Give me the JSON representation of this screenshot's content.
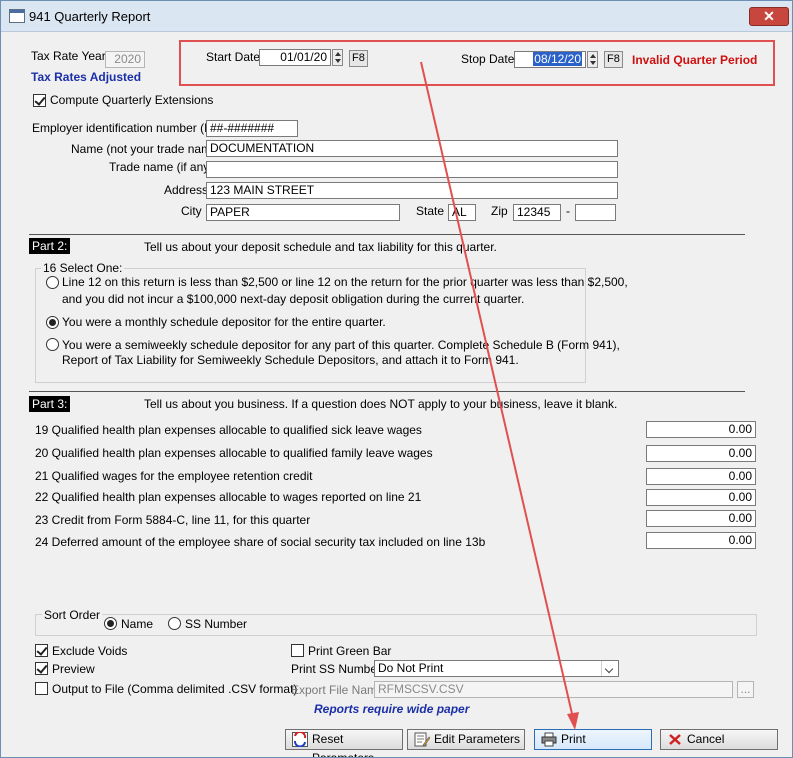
{
  "window": {
    "title": "941 Quarterly Report",
    "close_symbol": "✕"
  },
  "header": {
    "tax_rate_year_label": "Tax Rate Year",
    "tax_rate_year_value": "2020",
    "tax_rates_adjusted": "Tax Rates Adjusted",
    "compute_label": "Compute Quarterly Extensions",
    "start_date_label": "Start Date",
    "start_date_value": "01/01/20",
    "stop_date_label": "Stop Date",
    "stop_date_value": "08/12/20",
    "f8": "F8",
    "invalid_msg": "Invalid Quarter Period"
  },
  "employer": {
    "ein_label": "Employer identification number (EIN)",
    "ein_value": "##-#######",
    "name_label": "Name (not your trade name)",
    "name_value": "DOCUMENTATION",
    "trade_label": "Trade name (if any)",
    "trade_value": "",
    "address_label": "Address",
    "address_value": "123 MAIN STREET",
    "city_label": "City",
    "city_value": "PAPER",
    "state_label": "State",
    "state_value": "AL",
    "zip_label": "Zip",
    "zip_value": "12345",
    "zip_dash": "-",
    "zip4_value": ""
  },
  "part2": {
    "tag": "Part 2:",
    "text": "Tell us about your deposit schedule and tax liability for this quarter.",
    "group_label": "16 Select One:",
    "opt1_line1": "Line 12 on this return is less than $2,500 or line 12 on the return for the prior quarter was less than $2,500,",
    "opt1_line2": "and you did not incur a $100,000 next-day deposit obligation during the current quarter.",
    "opt2": "You were a monthly schedule depositor for the entire quarter.",
    "opt3_line1": "You were a semiweekly schedule depositor for any part of this quarter. Complete Schedule B (Form 941),",
    "opt3_line2": "Report of Tax Liability for Semiweekly Schedule Depositors, and attach it to Form 941."
  },
  "part3": {
    "tag": "Part 3:",
    "text": "Tell us about you business. If a question does NOT apply to your business, leave it blank.",
    "lines": [
      {
        "label": "19  Qualified health plan expenses allocable to qualified sick leave wages",
        "value": "0.00"
      },
      {
        "label": "20  Qualified health plan expenses allocable to qualified family leave wages",
        "value": "0.00"
      },
      {
        "label": "21  Qualified wages for the employee retention credit",
        "value": "0.00"
      },
      {
        "label": "22  Qualified health plan expenses allocable to wages reported on line 21",
        "value": "0.00"
      },
      {
        "label": "23  Credit from Form 5884-C, line 11, for this quarter",
        "value": "0.00"
      },
      {
        "label": "24  Deferred amount of the employee share of social security tax included on line 13b",
        "value": "0.00"
      }
    ]
  },
  "sort": {
    "label": "Sort Order",
    "opt_name": "Name",
    "opt_ss": "SS Number"
  },
  "options": {
    "exclude_voids": "Exclude Voids",
    "preview": "Preview",
    "output_file": "Output to File (Comma delimited .CSV format)",
    "print_green_bar": "Print Green Bar",
    "print_ss_label": "Print SS Number",
    "print_ss_value": "Do Not Print",
    "export_label": "Export File Name",
    "export_value": "RFMSCSV.CSV",
    "browse": "...",
    "wide_paper": "Reports require wide paper"
  },
  "buttons": {
    "reset": "Reset Parameters",
    "edit": "Edit Parameters",
    "print": "Print",
    "cancel": "Cancel"
  },
  "colors": {
    "accent_red": "#e05050",
    "label_blue": "#1a2fa8",
    "invalid_red": "#d01010"
  }
}
